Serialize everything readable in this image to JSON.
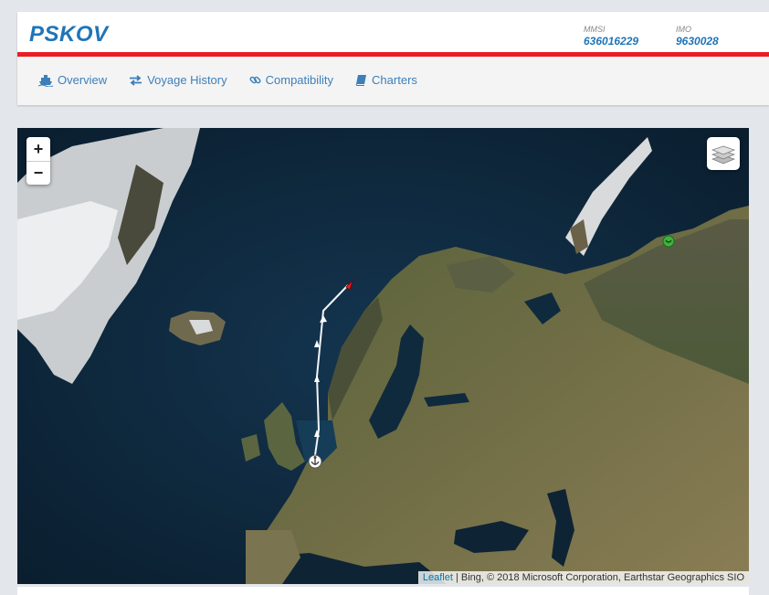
{
  "vessel": {
    "name": "PSKOV",
    "mmsi_label": "MMSI",
    "mmsi": "636016229",
    "imo_label": "IMO",
    "imo": "9630028"
  },
  "nav": {
    "overview": "Overview",
    "voyage_history": "Voyage History",
    "compatibility": "Compatibility",
    "charters": "Charters"
  },
  "map": {
    "zoom_in": "+",
    "zoom_out": "−",
    "attribution_link": "Leaflet",
    "attribution_text": " | Bing, © 2018 Microsoft Corporation, Earthstar Geographics SIO"
  },
  "colors": {
    "brand_blue": "#1f75b7",
    "accent_red": "#ec1c24",
    "nav_link": "#3d7fb9"
  }
}
